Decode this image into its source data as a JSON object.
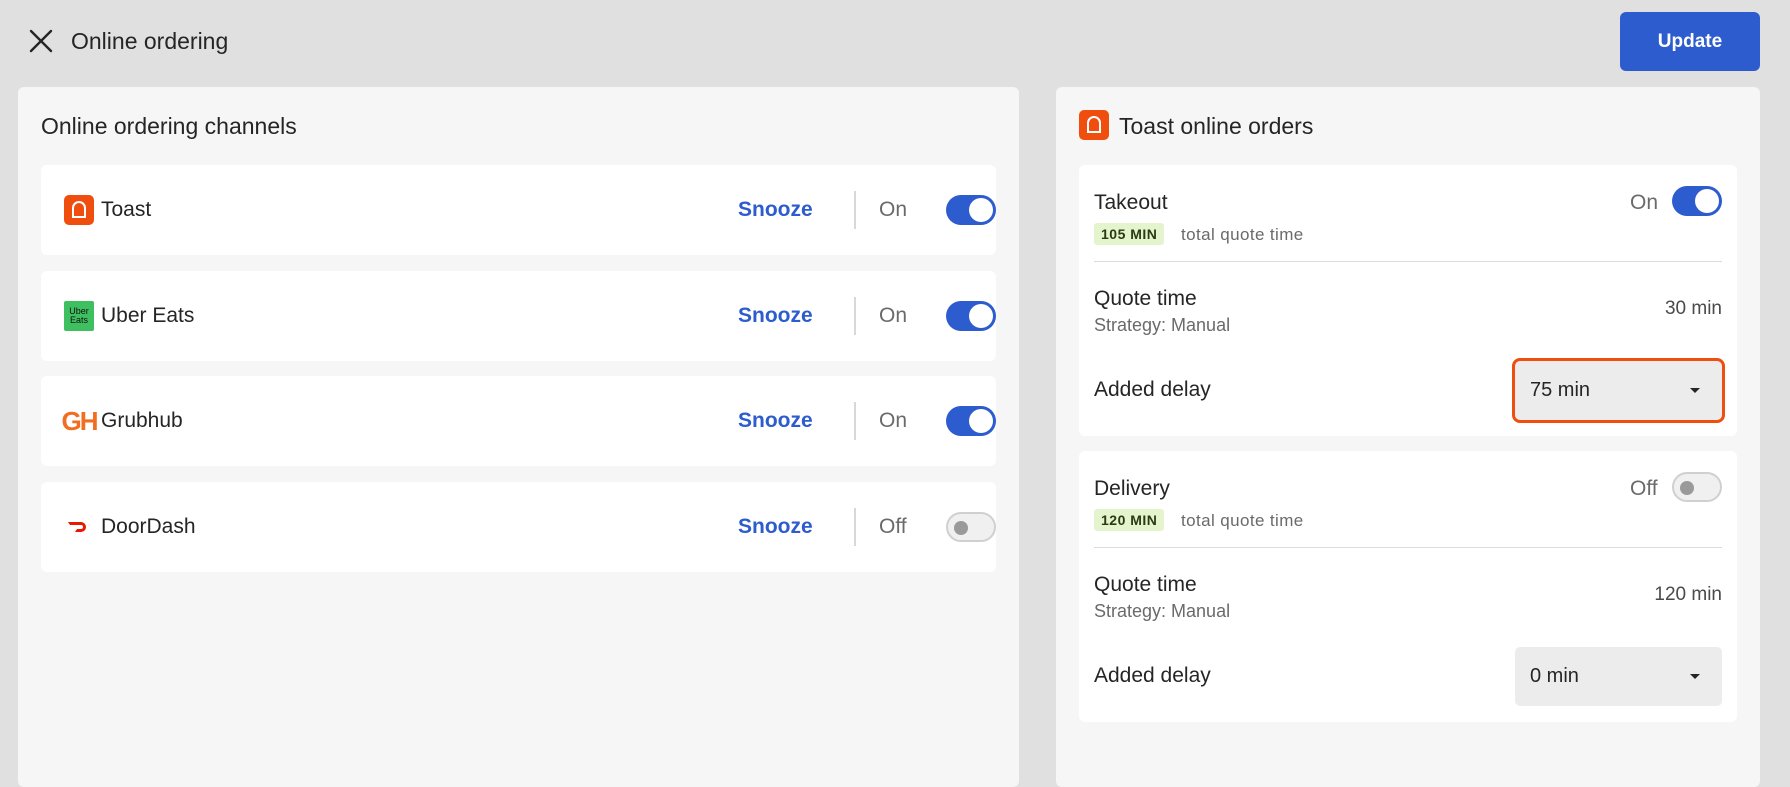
{
  "header": {
    "title": "Online ordering",
    "update_label": "Update"
  },
  "channels_panel": {
    "title": "Online ordering channels",
    "channels": [
      {
        "name": "Toast",
        "snooze_label": "Snooze",
        "state_label": "On",
        "enabled": true,
        "icon": "toast-icon",
        "color": "#f04e0f"
      },
      {
        "name": "Uber Eats",
        "snooze_label": "Snooze",
        "state_label": "On",
        "enabled": true,
        "icon": "uber-eats-icon",
        "icon_text": "Uber Eats",
        "color": "#3fc060"
      },
      {
        "name": "Grubhub",
        "snooze_label": "Snooze",
        "state_label": "On",
        "enabled": true,
        "icon": "grubhub-icon",
        "icon_text": "GH",
        "color": "#f36d21"
      },
      {
        "name": "DoorDash",
        "snooze_label": "Snooze",
        "state_label": "Off",
        "enabled": false,
        "icon": "doordash-icon",
        "color": "#eb1700"
      }
    ]
  },
  "orders_panel": {
    "title": "Toast online orders",
    "takeout": {
      "title": "Takeout",
      "state_label": "On",
      "enabled": true,
      "badge": "105 MIN",
      "badge_label": "total quote time",
      "quote_label": "Quote time",
      "strategy": "Strategy: Manual",
      "quote_value": "30 min",
      "delay_label": "Added delay",
      "delay_value": "75 min"
    },
    "delivery": {
      "title": "Delivery",
      "state_label": "Off",
      "enabled": false,
      "badge": "120 MIN",
      "badge_label": "total quote time",
      "quote_label": "Quote time",
      "strategy": "Strategy: Manual",
      "quote_value": "120 min",
      "delay_label": "Added delay",
      "delay_value": "0 min"
    }
  },
  "colors": {
    "accent": "#2d5ccf",
    "toast_brand": "#f04e0f",
    "badge_bg": "#e4f4cd"
  }
}
